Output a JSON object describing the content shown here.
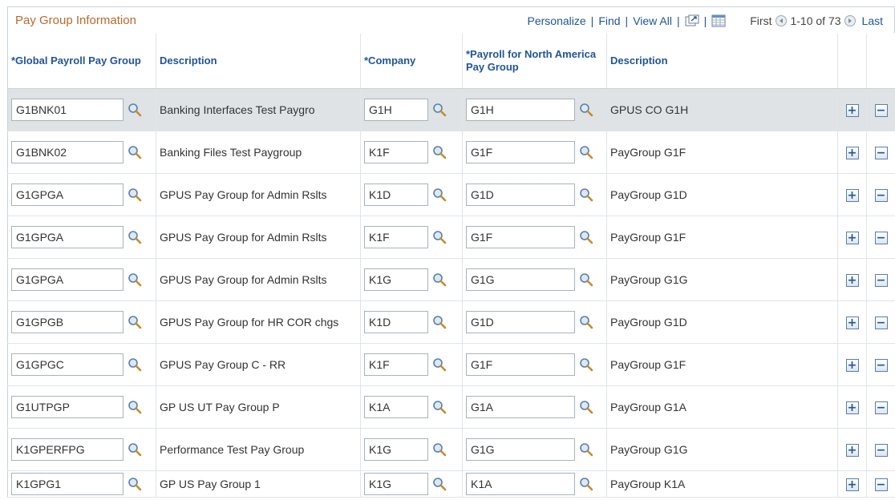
{
  "grid": {
    "title": "Pay Group Information",
    "nav": {
      "personalize": "Personalize",
      "find": "Find",
      "view_all": "View All",
      "first": "First",
      "range": "1-10 of 73",
      "last": "Last"
    },
    "columns": [
      "*Global Payroll Pay Group",
      "Description",
      "*Company",
      "*Payroll for North America Pay Group",
      "Description"
    ],
    "rows": [
      {
        "gp": "G1BNK01",
        "desc": "Banking Interfaces Test Paygro",
        "company": "G1H",
        "na": "G1H",
        "na_desc": "GPUS CO G1H"
      },
      {
        "gp": "G1BNK02",
        "desc": "Banking Files Test Paygroup",
        "company": "K1F",
        "na": "G1F",
        "na_desc": "PayGroup G1F"
      },
      {
        "gp": "G1GPGA",
        "desc": "GPUS Pay Group for Admin Rslts",
        "company": "K1D",
        "na": "G1D",
        "na_desc": "PayGroup G1D"
      },
      {
        "gp": "G1GPGA",
        "desc": "GPUS Pay Group for Admin Rslts",
        "company": "K1F",
        "na": "G1F",
        "na_desc": "PayGroup G1F"
      },
      {
        "gp": "G1GPGA",
        "desc": "GPUS Pay Group for Admin Rslts",
        "company": "K1G",
        "na": "G1G",
        "na_desc": "PayGroup G1G"
      },
      {
        "gp": "G1GPGB",
        "desc": "GPUS Pay Group for HR COR chgs",
        "company": "K1D",
        "na": "G1D",
        "na_desc": "PayGroup G1D"
      },
      {
        "gp": "G1GPGC",
        "desc": "GPUS Pay Group C - RR",
        "company": "K1F",
        "na": "G1F",
        "na_desc": "PayGroup G1F"
      },
      {
        "gp": "G1UTPGP",
        "desc": "GP US UT Pay Group P",
        "company": "K1A",
        "na": "G1A",
        "na_desc": "PayGroup G1A"
      },
      {
        "gp": "K1GPERFPG",
        "desc": "Performance Test Pay Group",
        "company": "K1G",
        "na": "G1G",
        "na_desc": "PayGroup G1G"
      },
      {
        "gp": "K1GPG1",
        "desc": "GP US Pay Group 1",
        "company": "K1G",
        "na": "K1A",
        "na_desc": "PayGroup K1A"
      }
    ],
    "add_label": "+",
    "delete_label": "−"
  },
  "icons": {
    "lookup": "magnifying-glass-icon",
    "zoom": "new-window-icon",
    "download": "spreadsheet-icon",
    "prev": "previous-arrow-icon",
    "next": "next-arrow-icon"
  },
  "colors": {
    "title": "#b86a2e",
    "link": "#20559a",
    "selected_row": "#dfe3e6"
  }
}
